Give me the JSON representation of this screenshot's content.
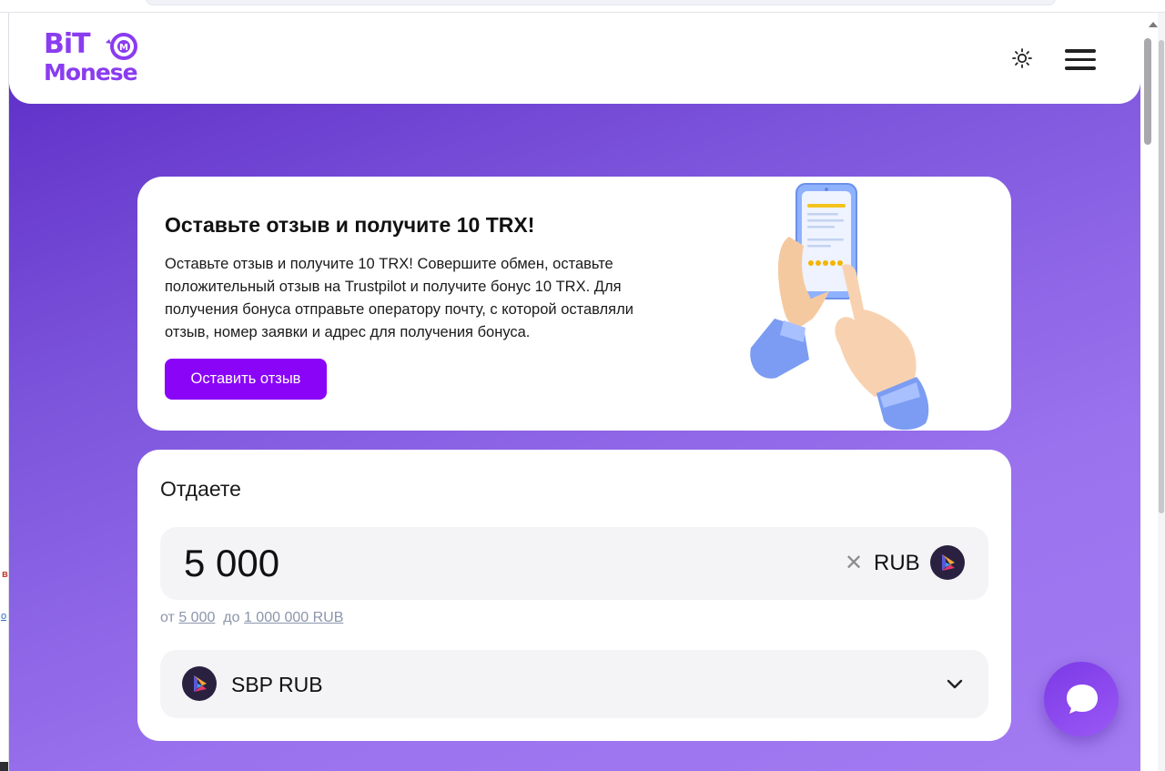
{
  "header": {
    "logo_line1": "BiT",
    "logo_line2": "Monese",
    "theme_icon": "sun-icon",
    "menu_icon": "hamburger-menu-icon"
  },
  "promo": {
    "title": "Оставьте отзыв и получите 10 TRX!",
    "text": "Оставьте отзыв и получите 10 TRX! Совершите обмен, оставьте положительный отзыв на Trustpilot и получите бонус 10 TRX. Для получения бонуса отправьте оператору почту, с которой оставляли отзыв, номер заявки и адрес для получения бонуса.",
    "button_label": "Оставить отзыв",
    "illustration": "phone-review-hand-illustration"
  },
  "exchange": {
    "give_label": "Отдаете",
    "amount_value": "5 000",
    "clear_icon": "close-icon",
    "currency": "RUB",
    "limits_from_label": "от",
    "limits_min": "5 000",
    "limits_to_label": "до",
    "limits_max": "1 000 000 RUB",
    "method_label": "SBP RUB",
    "method_icon": "sbp-icon"
  },
  "chat": {
    "icon": "chat-bubble-icon"
  },
  "colors": {
    "accent": "#8a05f7",
    "brand": "#8a3cf0",
    "background_gradient_start": "#5b2ac4",
    "background_gradient_end": "#a27bf2"
  }
}
